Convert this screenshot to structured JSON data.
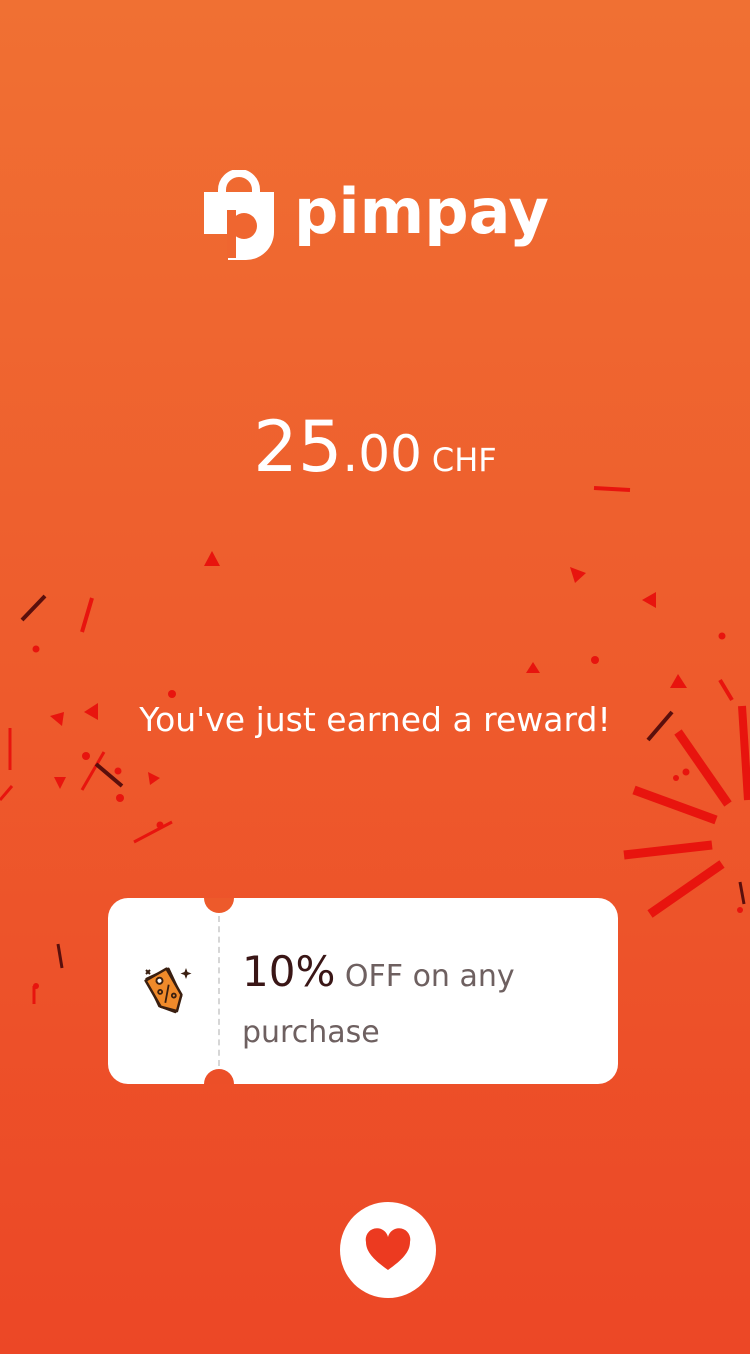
{
  "brand": {
    "name": "pimpay",
    "icon": "shopping-bag-p-logo-icon"
  },
  "reward": {
    "amount_integer": "25",
    "amount_decimal": ".00",
    "currency": "CHF",
    "headline": "You've just earned a reward!"
  },
  "coupon": {
    "icon": "discount-tag-icon",
    "percent": "10%",
    "description": "OFF on any purchase"
  },
  "actions": {
    "favorite_icon": "heart-icon"
  },
  "colors": {
    "background_top": "#f07033",
    "background_bottom": "#ec4726",
    "accent": "#ec3a20",
    "card": "#ffffff"
  }
}
